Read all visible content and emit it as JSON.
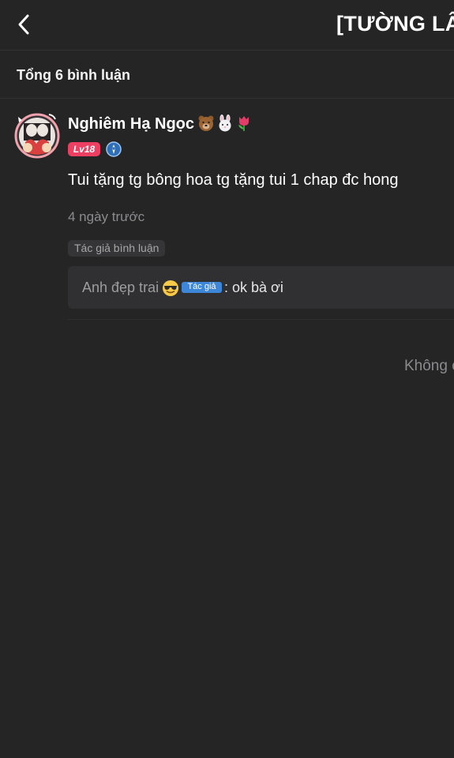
{
  "header": {
    "title": "[TƯỜNG LÂM",
    "back_icon": "chevron-left-icon"
  },
  "comments_summary": {
    "label": "Tổng 6 bình luận"
  },
  "comment": {
    "username": "Nghiêm Hạ Ngọc",
    "username_emojis": [
      "bear-face-emoji",
      "rabbit-face-emoji",
      "tulip-emoji"
    ],
    "level": "Lv18",
    "level_color": "#ec3f62",
    "medal_icon": "blue-medal-icon",
    "text": "Tui tặng tg bông hoa tg tặng tui 1 chap đc hong",
    "time": "4 ngày trước",
    "author_tag": "Tác giả bình luận",
    "reply": {
      "author": "Anh đẹp trai",
      "author_emoji": "sunglasses-face-emoji",
      "author_badge": "Tác giả",
      "author_badge_color": "#3d86d8",
      "text": ": ok bà ơi"
    }
  },
  "footer": {
    "end_text": "Không c"
  },
  "colors": {
    "background": "#252526",
    "reply_background": "#303032",
    "muted_text": "#8b8b8e"
  }
}
